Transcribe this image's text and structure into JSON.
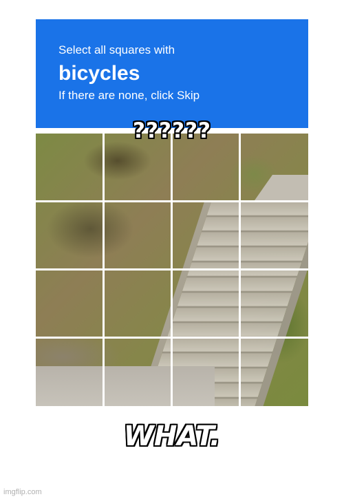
{
  "captcha": {
    "instruction": "Select all squares with",
    "target": "bicycles",
    "hint": "If there are none, click Skip",
    "header_color": "#1a73e8",
    "grid_rows": 4,
    "grid_cols": 4
  },
  "meme": {
    "top_text": "??????",
    "bottom_text": "WHAT."
  },
  "watermark": "imgflip.com"
}
